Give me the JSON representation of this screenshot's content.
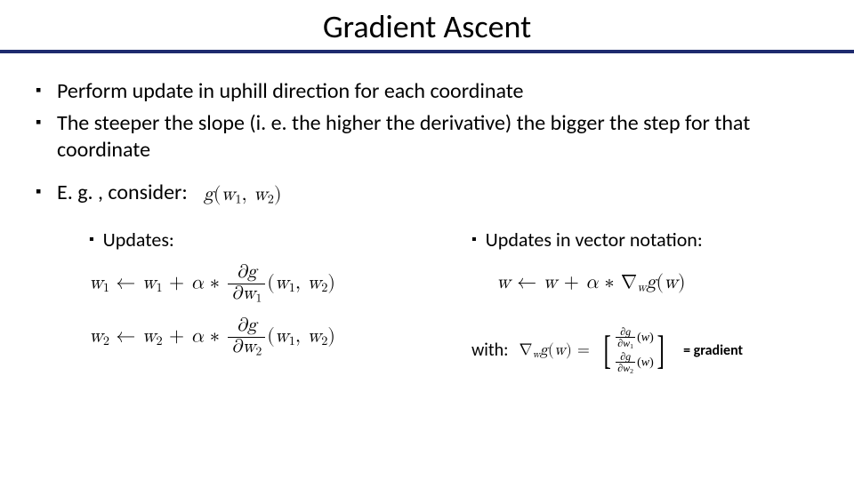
{
  "title": "Gradient Ascent",
  "bullets": {
    "b1": "Perform update in uphill direction for each coordinate",
    "b2": "The steeper the slope (i. e. the higher the derivative) the bigger the step for that coordinate",
    "b3": "E. g. , consider:"
  },
  "consider_fn": "g(w₁, w₂)",
  "left": {
    "heading": "Updates:",
    "eq1": {
      "lhs": "w₁",
      "arrow": "←",
      "rhs_a": "w₁ + α ∗",
      "frac_num": "∂g",
      "frac_den": "∂w₁",
      "args": "(w₁, w₂)"
    },
    "eq2": {
      "lhs": "w₂",
      "arrow": "←",
      "rhs_a": "w₂ + α ∗",
      "frac_num": "∂g",
      "frac_den": "∂w₂",
      "args": "(w₁, w₂)"
    }
  },
  "right": {
    "heading": "Updates in vector notation:",
    "vec_eqn": "w ← w + α ∗ ∇_w g(w)",
    "with_label": "with:",
    "grad_lhs": "∇_w g(w) =",
    "row1_num": "∂g",
    "row1_den": "∂w₁",
    "row2_num": "∂g",
    "row2_den": "∂w₂",
    "row_args": "(w)",
    "grad_name": "= gradient"
  }
}
